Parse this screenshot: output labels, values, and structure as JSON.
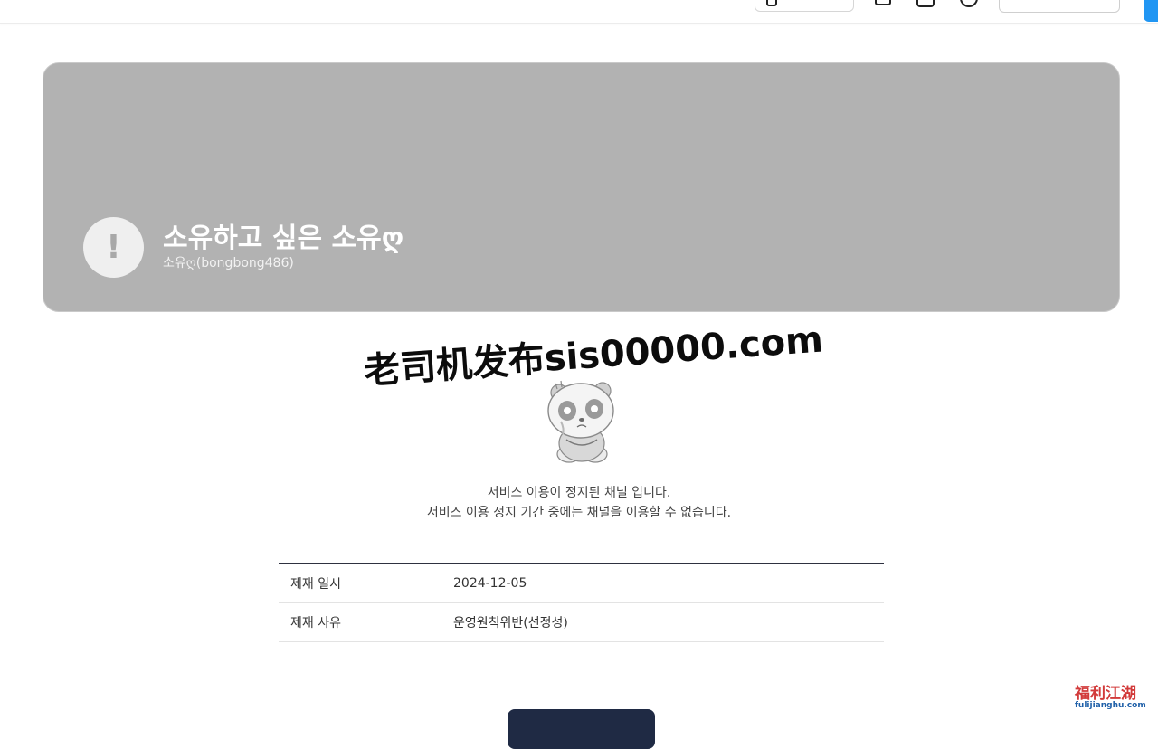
{
  "header": {
    "logo_fragment": "",
    "coin_label": "",
    "login_label": ""
  },
  "banner": {
    "channel_name": "소유하고 싶은 소유ღ",
    "channel_id": "소유ღ(bongbong486)",
    "avatar_symbol": "!"
  },
  "watermark": {
    "text": "老司机发布sis00000.com"
  },
  "notice": {
    "line1": "서비스 이용이 정지된 채널 입니다.",
    "line2": "서비스 이용 정지 기간 중에는 채널을 이용할 수 없습니다."
  },
  "sanction": {
    "rows": [
      {
        "label": "제재 일시",
        "value": "2024-12-05"
      },
      {
        "label": "제재 사유",
        "value": "운영원칙위반(선정성)"
      }
    ]
  },
  "corner_logo": {
    "title": "福利江湖",
    "subtitle": "fulijianghu.com"
  },
  "icons": [
    "coin-icon",
    "box-icon",
    "bell-icon",
    "clock-icon",
    "alert-icon",
    "crying-bear-icon"
  ],
  "colors": {
    "banner_bg": "#b2b2b2",
    "table_top_border": "#2e3140",
    "home_button": "#1f2a44",
    "accent_blue": "#2196f3"
  }
}
